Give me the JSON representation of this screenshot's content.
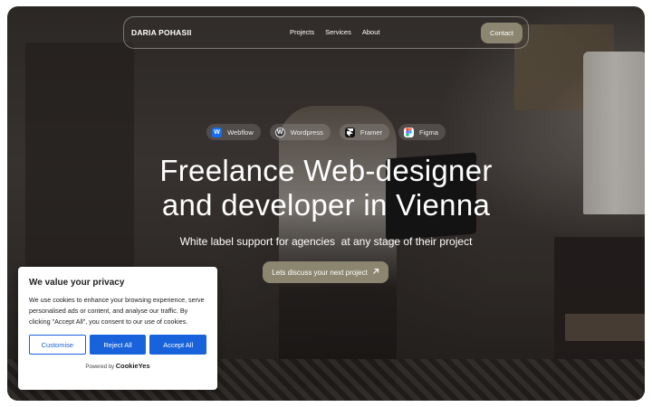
{
  "nav": {
    "brand": "DARIA POHASII",
    "links": [
      "Projects",
      "Services",
      "About"
    ],
    "contact_label": "Contact"
  },
  "tools": [
    {
      "label": "Webflow",
      "icon": "webflow-icon",
      "color": "#146ef5"
    },
    {
      "label": "Wordpress",
      "icon": "wordpress-icon",
      "color": "#3a3a3a"
    },
    {
      "label": "Framer",
      "icon": "framer-icon",
      "color": "#111111"
    },
    {
      "label": "Figma",
      "icon": "figma-icon",
      "color": "#f24e1e"
    }
  ],
  "hero": {
    "title_line1": "Freelance Web-designer",
    "title_line2": "and developer in Vienna",
    "subtitle": "White label support for agencies  at any stage of their project",
    "cta_label": "Lets discuss your next project",
    "cta_icon": "arrow-up-right-icon"
  },
  "cookie": {
    "heading": "We value your privacy",
    "body": "We use cookies to enhance your browsing experience, serve personalised ads or content, and analyse our traffic. By clicking \"Accept All\", you consent to our use of cookies.",
    "customise_label": "Customise",
    "reject_label": "Reject All",
    "accept_label": "Accept All",
    "powered_by": "Powered by",
    "powered_brand": "CookieYes"
  },
  "colors": {
    "accent": "#8c8670",
    "cookie_blue": "#1863dc"
  }
}
